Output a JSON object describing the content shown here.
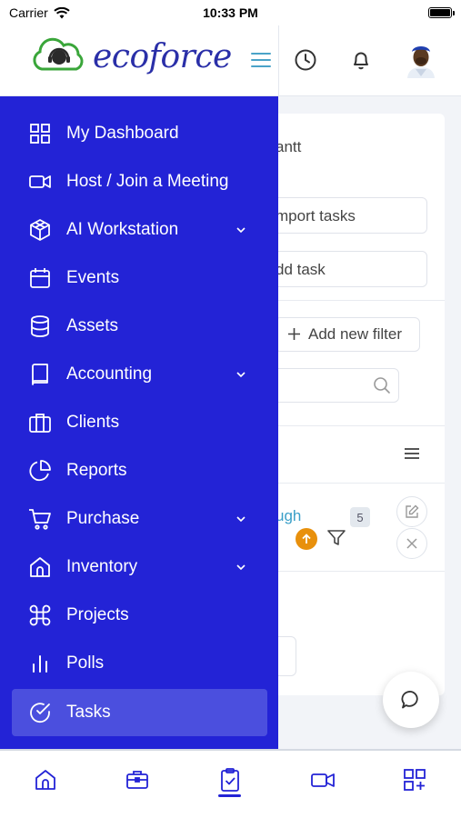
{
  "status_bar": {
    "carrier": "Carrier",
    "time": "10:33 PM"
  },
  "header": {
    "logo_prefix": "eco",
    "logo_suffix": "force"
  },
  "background": {
    "gantt": "antt",
    "import_tasks": "mport tasks",
    "add_task": "dd task",
    "add_new_filter": "Add new filter",
    "link_text": "ugh",
    "badge_count": "5"
  },
  "sidebar": {
    "items": [
      {
        "label": "My Dashboard",
        "icon": "grid-icon"
      },
      {
        "label": "Host / Join a Meeting",
        "icon": "video-icon"
      },
      {
        "label": "AI Workstation",
        "icon": "cube-icon",
        "expandable": true
      },
      {
        "label": "Events",
        "icon": "calendar-icon"
      },
      {
        "label": "Assets",
        "icon": "database-icon"
      },
      {
        "label": "Accounting",
        "icon": "book-icon",
        "expandable": true
      },
      {
        "label": "Clients",
        "icon": "briefcase-icon"
      },
      {
        "label": "Reports",
        "icon": "pie-chart-icon"
      },
      {
        "label": "Purchase",
        "icon": "cart-icon",
        "expandable": true
      },
      {
        "label": "Inventory",
        "icon": "home-icon",
        "expandable": true
      },
      {
        "label": "Projects",
        "icon": "command-icon"
      },
      {
        "label": "Polls",
        "icon": "bar-chart-icon"
      },
      {
        "label": "Tasks",
        "icon": "check-circle-icon",
        "active": true
      }
    ]
  },
  "tabbar": {
    "tabs": [
      {
        "icon": "home-icon"
      },
      {
        "icon": "briefcase-icon"
      },
      {
        "icon": "clipboard-check-icon",
        "active": true
      },
      {
        "icon": "video-icon"
      },
      {
        "icon": "grid-plus-icon"
      }
    ]
  },
  "colors": {
    "sidebar_bg": "#2323d6",
    "active_item": "#4b4fde",
    "accent_orange": "#e8900c",
    "logo_blue": "#2a2fa8",
    "logo_green": "#3aa63a"
  }
}
